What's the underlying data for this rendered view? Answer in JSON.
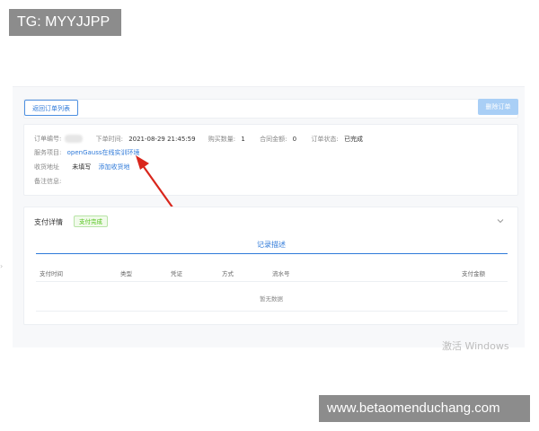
{
  "watermarks": {
    "top": "TG: MYYJJPP",
    "bottom": "www.betaomenduchang.com"
  },
  "toolbar": {
    "back_label": "返回订单列表",
    "delete_label": "删除订单"
  },
  "order": {
    "id_label": "订单编号:",
    "time_label": "下单时间:",
    "time_value": "2021-08-29 21:45:59",
    "qty_label": "购买数量:",
    "qty_value": "1",
    "amount_label": "合同金额:",
    "amount_value": "0",
    "status_label": "订单状态:",
    "status_value": "已完成",
    "service_label": "服务项目:",
    "service_value": "openGauss在线实训环境",
    "address_label": "收货地址",
    "address_value": "未填写",
    "address_link": "添加收货地",
    "remark_label": "备注信息:"
  },
  "payment": {
    "title": "支付详情",
    "badge": "支付完成",
    "tab": "记录描述",
    "columns": [
      "支付时间",
      "类型",
      "凭证",
      "方式",
      "流水号",
      "支付金额"
    ],
    "empty_text": "暂无数据"
  },
  "system": {
    "activate_text": "激活 Windows"
  },
  "colors": {
    "accent": "#2f7ad9",
    "success": "#52c41a",
    "annotation_arrow": "#d9261c"
  }
}
